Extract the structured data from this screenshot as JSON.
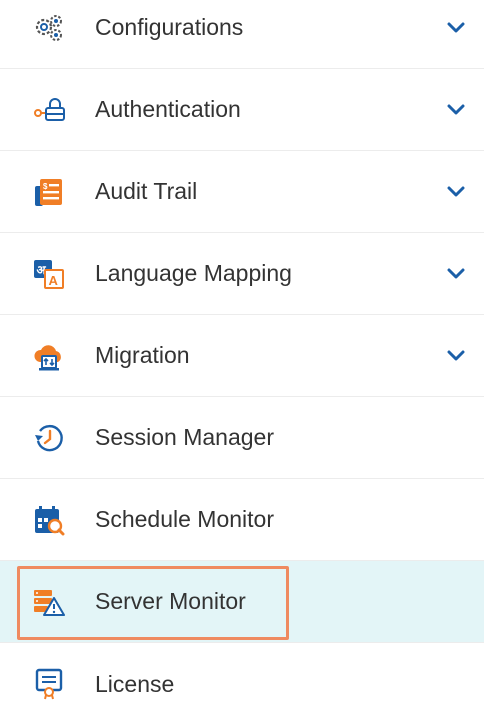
{
  "menu": {
    "items": [
      {
        "label": "Configurations",
        "icon": "gears-icon",
        "expandable": true
      },
      {
        "label": "Authentication",
        "icon": "key-lock-icon",
        "expandable": true
      },
      {
        "label": "Audit Trail",
        "icon": "audit-ledger-icon",
        "expandable": true
      },
      {
        "label": "Language Mapping",
        "icon": "language-translate-icon",
        "expandable": true
      },
      {
        "label": "Migration",
        "icon": "cloud-migration-icon",
        "expandable": true
      },
      {
        "label": "Session Manager",
        "icon": "clock-history-icon",
        "expandable": false
      },
      {
        "label": "Schedule Monitor",
        "icon": "calendar-search-icon",
        "expandable": false
      },
      {
        "label": "Server Monitor",
        "icon": "server-warning-icon",
        "expandable": false,
        "selected": true
      },
      {
        "label": "License",
        "icon": "license-certificate-icon",
        "expandable": false
      }
    ]
  },
  "colors": {
    "accent": "#1b5fa8",
    "icon_orange": "#f07e26",
    "selected_bg": "#e3f5f7",
    "highlight_border": "#ef8a60"
  }
}
